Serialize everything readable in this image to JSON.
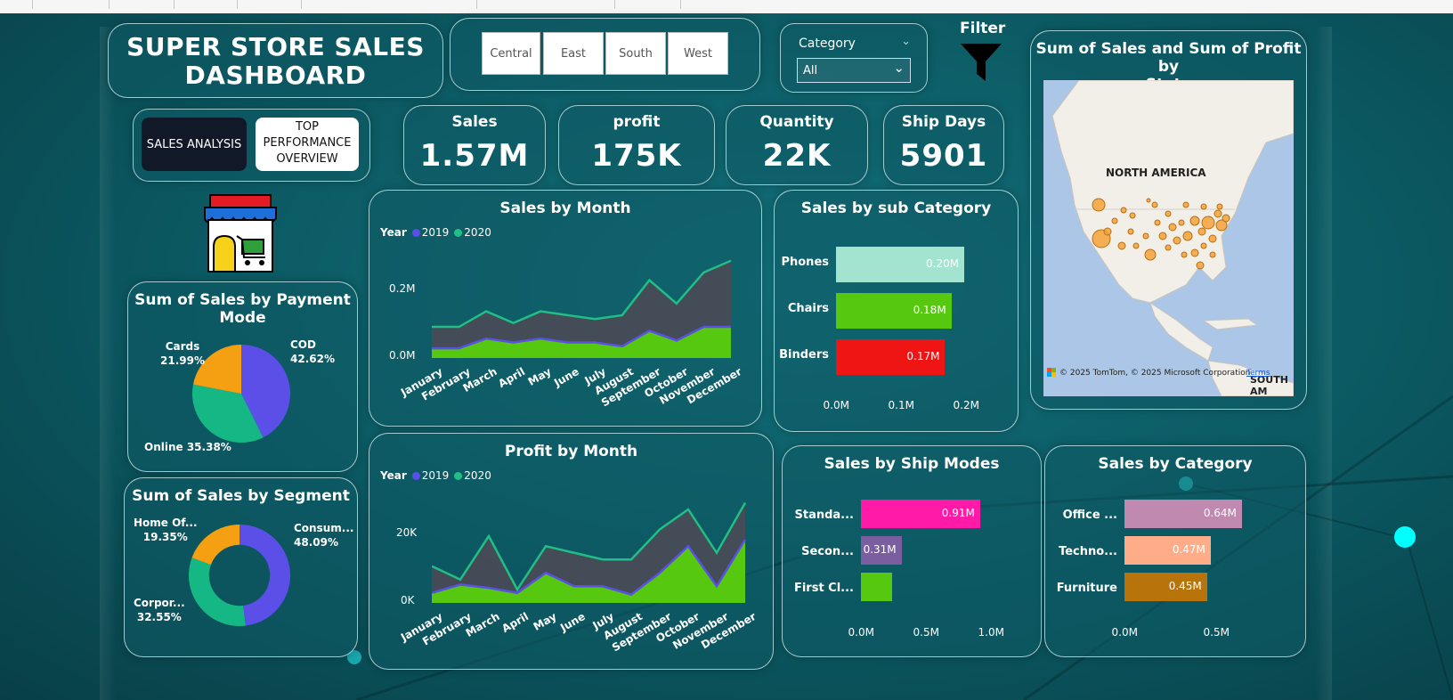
{
  "dashboard": {
    "title_line1": "SUPER STORE SALES",
    "title_line2": "DASHBOARD",
    "regions": [
      "Central",
      "East",
      "South",
      "West"
    ],
    "category_filter": {
      "label": "Category",
      "value": "All"
    },
    "filter_label": "Filter",
    "nav": {
      "sales_analysis": "SALES ANALYSIS",
      "top_line1": "TOP",
      "top_line2": "PERFORMANCE",
      "top_line3": "OVERVIEW"
    },
    "kpis": [
      {
        "label": "Sales",
        "value": "1.57M"
      },
      {
        "label": "profit",
        "value": "175K"
      },
      {
        "label": "Quantity",
        "value": "22K"
      },
      {
        "label": "Ship Days",
        "value": "5901"
      }
    ]
  },
  "colors": {
    "y2019": "#5b4fe8",
    "y2020": "#1fbf86",
    "area_fill": "#56c80f",
    "area_top": "#4a4a55"
  },
  "payment": {
    "title_line1": "Sum of Sales by Payment",
    "title_line2": "Mode",
    "slices": [
      {
        "name": "COD",
        "pct": "42.62%",
        "value": 42.62,
        "color": "#5b4fe8"
      },
      {
        "name": "Online",
        "pct": "35.38%",
        "value": 35.38,
        "color": "#15b884"
      },
      {
        "name": "Cards",
        "pct": "21.99%",
        "value": 21.99,
        "color": "#f4a012"
      }
    ],
    "labels": {
      "cards": "Cards",
      "cards_pct": "21.99%",
      "cod": "COD",
      "cod_pct": "42.62%",
      "online": "Online 35.38%"
    }
  },
  "segment": {
    "title": "Sum of Sales by Segment",
    "slices": [
      {
        "name": "Consum...",
        "pct": "48.09%",
        "value": 48.09,
        "color": "#5b4fe8"
      },
      {
        "name": "Corpor...",
        "pct": "32.55%",
        "value": 32.55,
        "color": "#15b884"
      },
      {
        "name": "Home Of...",
        "pct": "19.35%",
        "value": 19.35,
        "color": "#f4a012"
      }
    ]
  },
  "sales_month": {
    "title": "Sales by Month",
    "legend_title": "Year",
    "legend": [
      "2019",
      "2020"
    ],
    "yticks": [
      "0.2M",
      "0.0M"
    ],
    "months": [
      "January",
      "February",
      "March",
      "April",
      "May",
      "June",
      "July",
      "August",
      "September",
      "October",
      "November",
      "December"
    ]
  },
  "profit_month": {
    "title": "Profit by Month",
    "legend_title": "Year",
    "legend": [
      "2019",
      "2020"
    ],
    "yticks": [
      "20K",
      "0K"
    ]
  },
  "subcategory": {
    "title": "Sales by sub Category",
    "bars": [
      {
        "label": "Phones",
        "value_text": "0.20M",
        "value": 0.2,
        "color": "#a3e4d0"
      },
      {
        "label": "Chairs",
        "value_text": "0.18M",
        "value": 0.18,
        "color": "#56c80f"
      },
      {
        "label": "Binders",
        "value_text": "0.17M",
        "value": 0.17,
        "color": "#f01515"
      }
    ],
    "xticks": [
      "0.0M",
      "0.1M",
      "0.2M"
    ]
  },
  "shipmodes": {
    "title": "Sales by Ship Modes",
    "bars": [
      {
        "label": "Standa...",
        "value_text": "0.91M",
        "value": 0.91,
        "color": "#ff1aa8"
      },
      {
        "label": "Secon...",
        "value_text": "0.31M",
        "value": 0.31,
        "color": "#7b5ea0"
      },
      {
        "label": "First Cl...",
        "value_text": "",
        "value": 0.24,
        "color": "#56c80f"
      }
    ],
    "xticks": [
      "0.0M",
      "0.5M",
      "1.0M"
    ]
  },
  "category": {
    "title": "Sales by Category",
    "bars": [
      {
        "label": "Office ...",
        "value_text": "0.64M",
        "value": 0.64,
        "color": "#c089b0"
      },
      {
        "label": "Techno...",
        "value_text": "0.47M",
        "value": 0.47,
        "color": "#ffad88"
      },
      {
        "label": "Furniture",
        "value_text": "0.45M",
        "value": 0.45,
        "color": "#b8740a"
      }
    ],
    "xticks": [
      "0.0M",
      "0.5M"
    ]
  },
  "map": {
    "title_line1": "Sum of Sales and Sum of Profit by",
    "title_line2": "State",
    "label_na": "NORTH AMERICA",
    "label_sa": "SOUTH AM",
    "attribution": "© 2025 TomTom, © 2025 Microsoft Corporation",
    "terms": "Terms"
  },
  "chart_data": [
    {
      "type": "area",
      "title": "Sales by Month",
      "legend_title": "Year",
      "categories": [
        "January",
        "February",
        "March",
        "April",
        "May",
        "June",
        "July",
        "August",
        "September",
        "October",
        "November",
        "December"
      ],
      "series": [
        {
          "name": "2019",
          "values": [
            0.025,
            0.025,
            0.05,
            0.04,
            0.05,
            0.04,
            0.04,
            0.03,
            0.07,
            0.045,
            0.08,
            0.08
          ]
        },
        {
          "name": "2020",
          "values": [
            0.08,
            0.08,
            0.12,
            0.09,
            0.12,
            0.11,
            0.1,
            0.11,
            0.2,
            0.14,
            0.22,
            0.25
          ]
        }
      ],
      "ylim": [
        0,
        0.27
      ]
    },
    {
      "type": "area",
      "title": "Profit by Month",
      "legend_title": "Year",
      "categories": [
        "January",
        "February",
        "March",
        "April",
        "May",
        "June",
        "July",
        "August",
        "September",
        "October",
        "November",
        "December"
      ],
      "series": [
        {
          "name": "2019",
          "values": [
            3000,
            5500,
            4500,
            3000,
            9000,
            5000,
            5000,
            2500,
            9000,
            17000,
            5000,
            19000
          ]
        },
        {
          "name": "2020",
          "values": [
            11000,
            7000,
            20000,
            4000,
            17000,
            15000,
            13000,
            13000,
            22000,
            28000,
            15000,
            30000
          ]
        }
      ],
      "ylim": [
        0,
        32000
      ]
    },
    {
      "type": "pie",
      "title": "Sum of Sales by Payment Mode",
      "categories": [
        "COD",
        "Online",
        "Cards"
      ],
      "values": [
        42.62,
        35.38,
        21.99
      ]
    },
    {
      "type": "pie",
      "title": "Sum of Sales by Segment",
      "categories": [
        "Consum...",
        "Corpor...",
        "Home Of..."
      ],
      "values": [
        48.09,
        32.55,
        19.35
      ]
    },
    {
      "type": "bar",
      "title": "Sales by sub Category",
      "categories": [
        "Phones",
        "Chairs",
        "Binders"
      ],
      "values": [
        0.2,
        0.18,
        0.17
      ],
      "xlim": [
        0,
        0.2
      ]
    },
    {
      "type": "bar",
      "title": "Sales by Ship Modes",
      "categories": [
        "Standa...",
        "Secon...",
        "First Cl..."
      ],
      "values": [
        0.91,
        0.31,
        0.24
      ],
      "xlim": [
        0,
        1.0
      ]
    },
    {
      "type": "bar",
      "title": "Sales by Category",
      "categories": [
        "Office ...",
        "Techno...",
        "Furniture"
      ],
      "values": [
        0.64,
        0.47,
        0.45
      ],
      "xlim": [
        0,
        0.5
      ]
    }
  ]
}
